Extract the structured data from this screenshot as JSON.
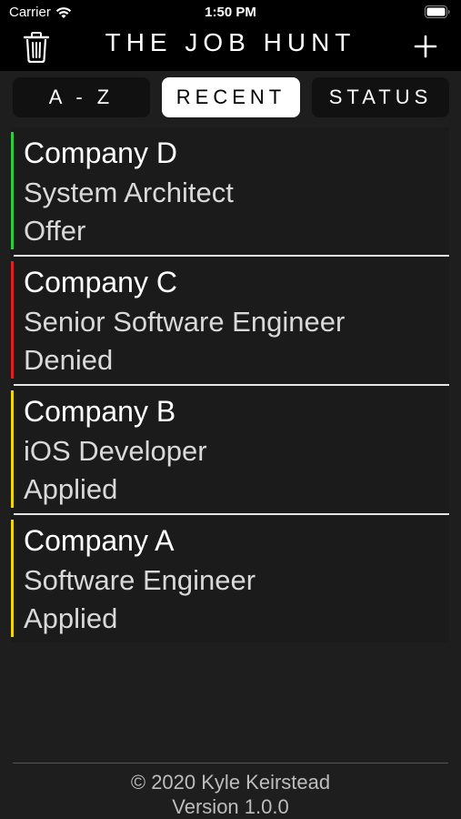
{
  "status_bar": {
    "carrier": "Carrier",
    "time": "1:50 PM"
  },
  "nav": {
    "title": "THE JOB HUNT",
    "left_icon": "trash-icon",
    "right_icon": "plus-icon"
  },
  "sort_tabs": [
    {
      "label": "A - Z",
      "selected": false
    },
    {
      "label": "RECENT",
      "selected": true
    },
    {
      "label": "STATUS",
      "selected": false
    }
  ],
  "jobs": [
    {
      "company": "Company D",
      "position": "System Architect",
      "status": "Offer",
      "color": "#2ecc40"
    },
    {
      "company": "Company C",
      "position": "Senior Software Engineer",
      "status": "Denied",
      "color": "#e02020"
    },
    {
      "company": "Company B",
      "position": "iOS Developer",
      "status": "Applied",
      "color": "#f0d800"
    },
    {
      "company": "Company A",
      "position": "Software Engineer",
      "status": "Applied",
      "color": "#f0d800"
    }
  ],
  "footer": {
    "copyright": "© 2020 Kyle Keirstead",
    "version": "Version 1.0.0"
  }
}
